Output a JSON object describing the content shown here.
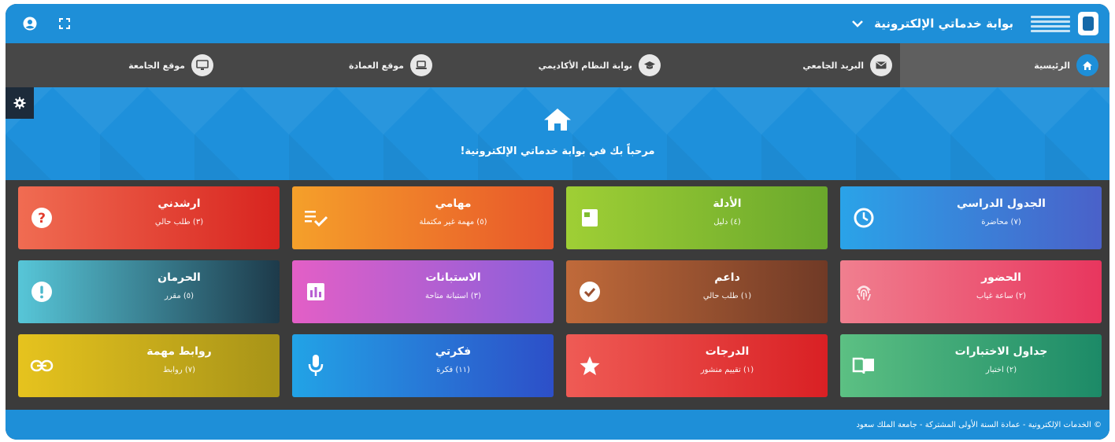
{
  "header": {
    "brand": "بوابة خدماتي الإلكترونية"
  },
  "nav": {
    "items": [
      {
        "label": "الرئيسية",
        "icon": "home-icon",
        "active": true
      },
      {
        "label": "البريد الجامعي",
        "icon": "mail-icon",
        "active": false
      },
      {
        "label": "بوابة النظام الأكاديمي",
        "icon": "graduation-cap-icon",
        "active": false
      },
      {
        "label": "موقع العمادة",
        "icon": "laptop-icon",
        "active": false
      },
      {
        "label": "موقع الجامعة",
        "icon": "monitor-icon",
        "active": false
      }
    ]
  },
  "hero": {
    "welcome": "مرحباً بك في بوابة خدماتي الإلكترونية!"
  },
  "cards": [
    {
      "title": "الجدول الدراسي",
      "subtitle": "(٧) محاضرة",
      "icon": "clock-icon",
      "colors": [
        "#4a61c9",
        "#2aa3e8"
      ]
    },
    {
      "title": "الأدلة",
      "subtitle": "(٤) دليل",
      "icon": "guide-book-icon",
      "colors": [
        "#6aa82c",
        "#9fcf35"
      ]
    },
    {
      "title": "مهامي",
      "subtitle": "(٥) مهمة غير مكتملة",
      "icon": "task-list-icon",
      "colors": [
        "#e8562a",
        "#f5a02a"
      ]
    },
    {
      "title": "ارشدني",
      "subtitle": "(٣) طلب حالي",
      "icon": "question-icon",
      "colors": [
        "#d8241f",
        "#f06c52"
      ]
    },
    {
      "title": "الحضور",
      "subtitle": "(٢) ساعة غياب",
      "icon": "fingerprint-icon",
      "colors": [
        "#e8365e",
        "#f07f8f"
      ]
    },
    {
      "title": "داعم",
      "subtitle": "(١) طلب حالي",
      "icon": "check-circle-icon",
      "colors": [
        "#703a26",
        "#c06a3a"
      ]
    },
    {
      "title": "الاستبانات",
      "subtitle": "(٣) استبانة متاحة",
      "icon": "survey-chart-icon",
      "colors": [
        "#8b5fdb",
        "#e35fc6"
      ]
    },
    {
      "title": "الحرمان",
      "subtitle": "(٥) مقرر",
      "icon": "alert-circle-icon",
      "colors": [
        "#1d3a4a",
        "#57c6d8"
      ]
    },
    {
      "title": "جداول الاختبارات",
      "subtitle": "(٢) اختبار",
      "icon": "open-book-icon",
      "colors": [
        "#1c8a67",
        "#5cc083"
      ]
    },
    {
      "title": "الدرجات",
      "subtitle": "(١) تقييم منشور",
      "icon": "star-icon",
      "colors": [
        "#d92024",
        "#ef5b55"
      ]
    },
    {
      "title": "فكرتي",
      "subtitle": "(١١) فكرة",
      "icon": "microphone-icon",
      "colors": [
        "#2d4fc8",
        "#22a3e6"
      ]
    },
    {
      "title": "روابط مهمة",
      "subtitle": "(٧) روابط",
      "icon": "link-icon",
      "colors": [
        "#a79318",
        "#e6c31e"
      ]
    }
  ],
  "footer": {
    "text": "© الخدمات الإلكترونية - عمادة السنة الأولى المشتركة - جامعة الملك سعود"
  },
  "colors": {
    "primary": "#1e8fd8",
    "nav_bg": "#474747",
    "body_bg": "#3b3b3b"
  }
}
